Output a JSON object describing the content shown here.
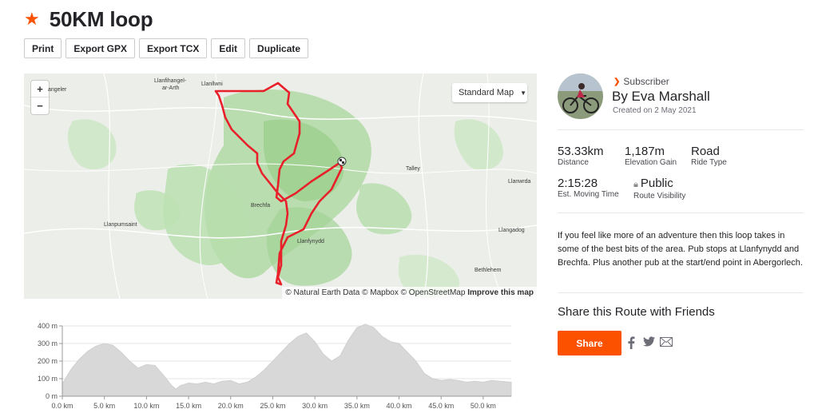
{
  "route": {
    "title": "50KM loop",
    "star_icon": "star-icon"
  },
  "actions": {
    "print": "Print",
    "export_gpx": "Export GPX",
    "export_tcx": "Export TCX",
    "edit": "Edit",
    "duplicate": "Duplicate"
  },
  "map": {
    "zoom_in": "+",
    "zoom_out": "−",
    "style_label": "Standard Map",
    "places": [
      "Llanfihangel-",
      "ar-Arth",
      "Llanllwni",
      "Talley",
      "Llanwrda",
      "Brechfa",
      "Llanpumsaint",
      "Llanfynydd",
      "Llangadog",
      "Bethlehem",
      "angeler"
    ],
    "attribution": "© Natural Earth Data © Mapbox © OpenStreetMap",
    "improve": "Improve this map",
    "route_color": "#e8202a"
  },
  "elevation": {
    "y_ticks": [
      "400 m",
      "300 m",
      "200 m",
      "100 m",
      "0 m"
    ],
    "x_ticks": [
      "0.0 km",
      "5.0 km",
      "10.0 km",
      "15.0 km",
      "20.0 km",
      "25.0 km",
      "30.0 km",
      "35.0 km",
      "40.0 km",
      "45.0 km",
      "50.0 km"
    ]
  },
  "author": {
    "badge": "Subscriber",
    "name": "By Eva Marshall",
    "created": "Created on 2 May 2021"
  },
  "stats": {
    "distance": {
      "value": "53.33km",
      "label": "Distance"
    },
    "elevation_gain": {
      "value": "1,187m",
      "label": "Elevation Gain"
    },
    "ride_type": {
      "value": "Road",
      "label": "Ride Type"
    },
    "moving_time": {
      "value": "2:15:28",
      "label": "Est. Moving Time"
    },
    "visibility": {
      "value": "Public",
      "label": "Route Visibility"
    }
  },
  "description": "If you feel like more of an adventure then this loop takes in some of the best bits of the area. Pub stops at Llanfynydd and Brechfa. Plus another pub at the start/end point in Abergorlech.",
  "share": {
    "title": "Share this Route with Friends",
    "button": "Share"
  },
  "colors": {
    "brand": "#fc5200"
  },
  "chart_data": {
    "type": "area",
    "title": "",
    "xlabel": "",
    "ylabel": "",
    "x_unit": "km",
    "y_unit": "m",
    "xlim": [
      0,
      53.33
    ],
    "ylim": [
      0,
      400
    ],
    "grid": true,
    "x": [
      0,
      1,
      2,
      3,
      4,
      5,
      6,
      7,
      8,
      9,
      10,
      11,
      12,
      13,
      13.5,
      14,
      15,
      16,
      17,
      18,
      19,
      20,
      21,
      22,
      23,
      24,
      25,
      26,
      27,
      28,
      29,
      30,
      31,
      32,
      33,
      34,
      35,
      36,
      37,
      38,
      39,
      40,
      41,
      42,
      43,
      44,
      45,
      46,
      47,
      48,
      49,
      50,
      51,
      52,
      53.33
    ],
    "series": [
      {
        "values": [
          70,
          150,
          210,
          255,
          285,
          300,
          290,
          250,
          200,
          160,
          180,
          175,
          120,
          60,
          40,
          60,
          75,
          70,
          80,
          70,
          85,
          90,
          70,
          80,
          110,
          150,
          200,
          250,
          300,
          340,
          360,
          310,
          240,
          200,
          230,
          320,
          390,
          410,
          390,
          340,
          310,
          300,
          250,
          200,
          130,
          100,
          90,
          95,
          90,
          80,
          85,
          80,
          90,
          85,
          80
        ]
      }
    ]
  }
}
